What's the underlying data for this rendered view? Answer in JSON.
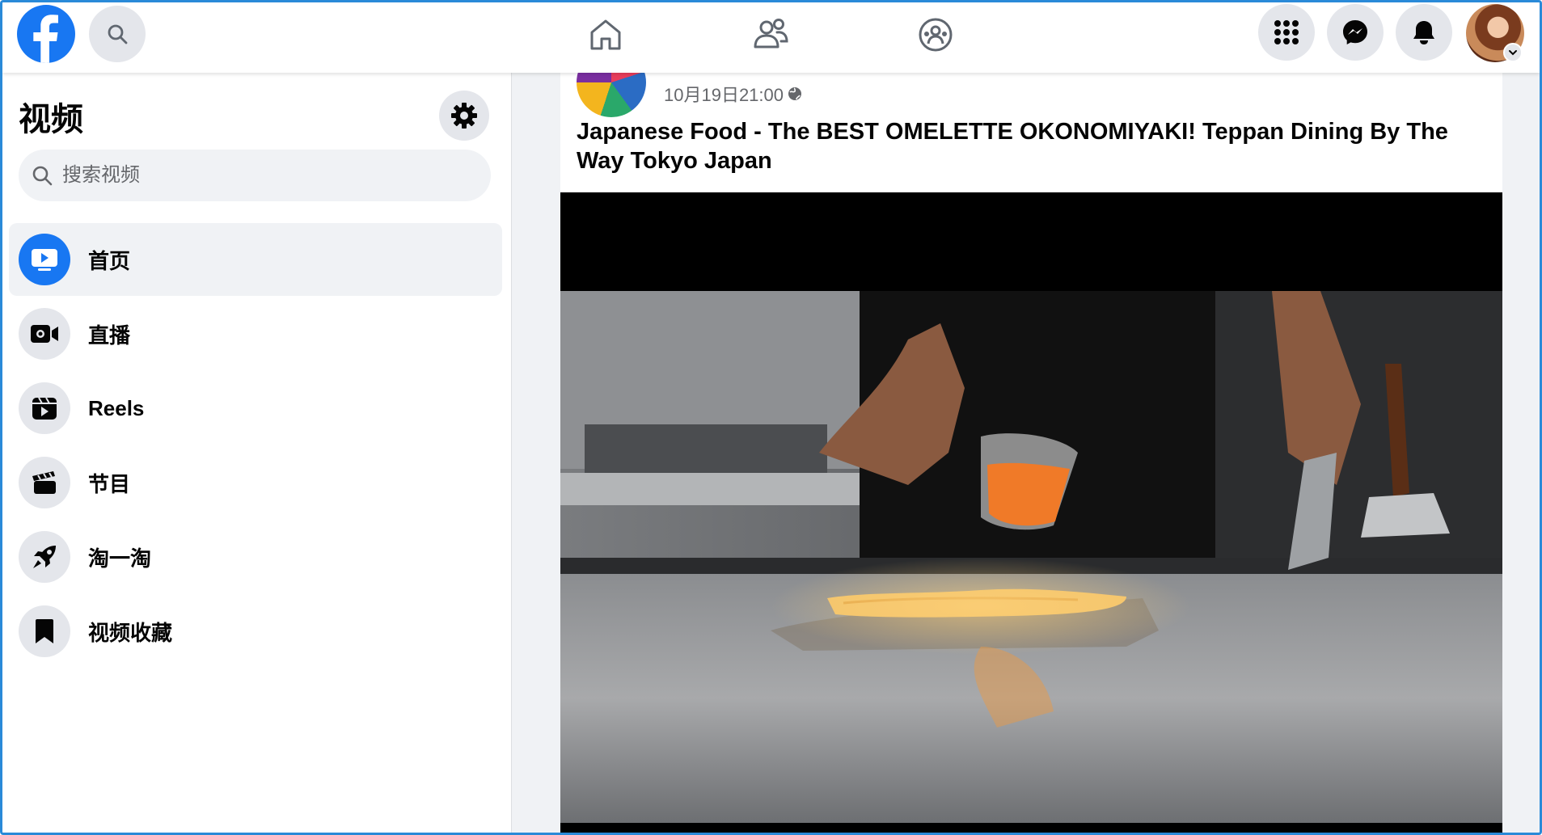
{
  "colors": {
    "brand": "#1877f2",
    "frame_border": "#2a8ad8",
    "page_bg": "#f0f2f5",
    "active_item_bg": "#f0f2f5",
    "icon_bg": "#e4e6eb"
  },
  "topbar": {
    "logo_icon": "facebook-logo",
    "search_icon": "search-icon",
    "nav": [
      {
        "name": "home-icon"
      },
      {
        "name": "friends-icon"
      },
      {
        "name": "groups-icon"
      }
    ],
    "right": [
      {
        "name": "menu-grid-icon"
      },
      {
        "name": "messenger-icon"
      },
      {
        "name": "notifications-icon"
      }
    ],
    "avatar_icon": "profile-avatar"
  },
  "sidebar": {
    "title": "视频",
    "settings_icon": "gear-icon",
    "search": {
      "placeholder": "搜索视频",
      "value": ""
    },
    "items": [
      {
        "label": "首页",
        "icon": "video-home-icon",
        "active": true
      },
      {
        "label": "直播",
        "icon": "live-camera-icon",
        "active": false
      },
      {
        "label": "Reels",
        "icon": "reels-icon",
        "active": false
      },
      {
        "label": "节目",
        "icon": "clapperboard-icon",
        "active": false
      },
      {
        "label": "淘一淘",
        "icon": "rocket-icon",
        "active": false
      },
      {
        "label": "视频收藏",
        "icon": "bookmark-icon",
        "active": false
      }
    ]
  },
  "post": {
    "time": "10月19日21:00",
    "privacy_icon": "globe-icon",
    "title": "Japanese Food - The BEST OMELETTE OKONOMIYAKI! Teppan Dining By The Way Tokyo Japan",
    "video": {
      "progress": 0.0
    }
  }
}
